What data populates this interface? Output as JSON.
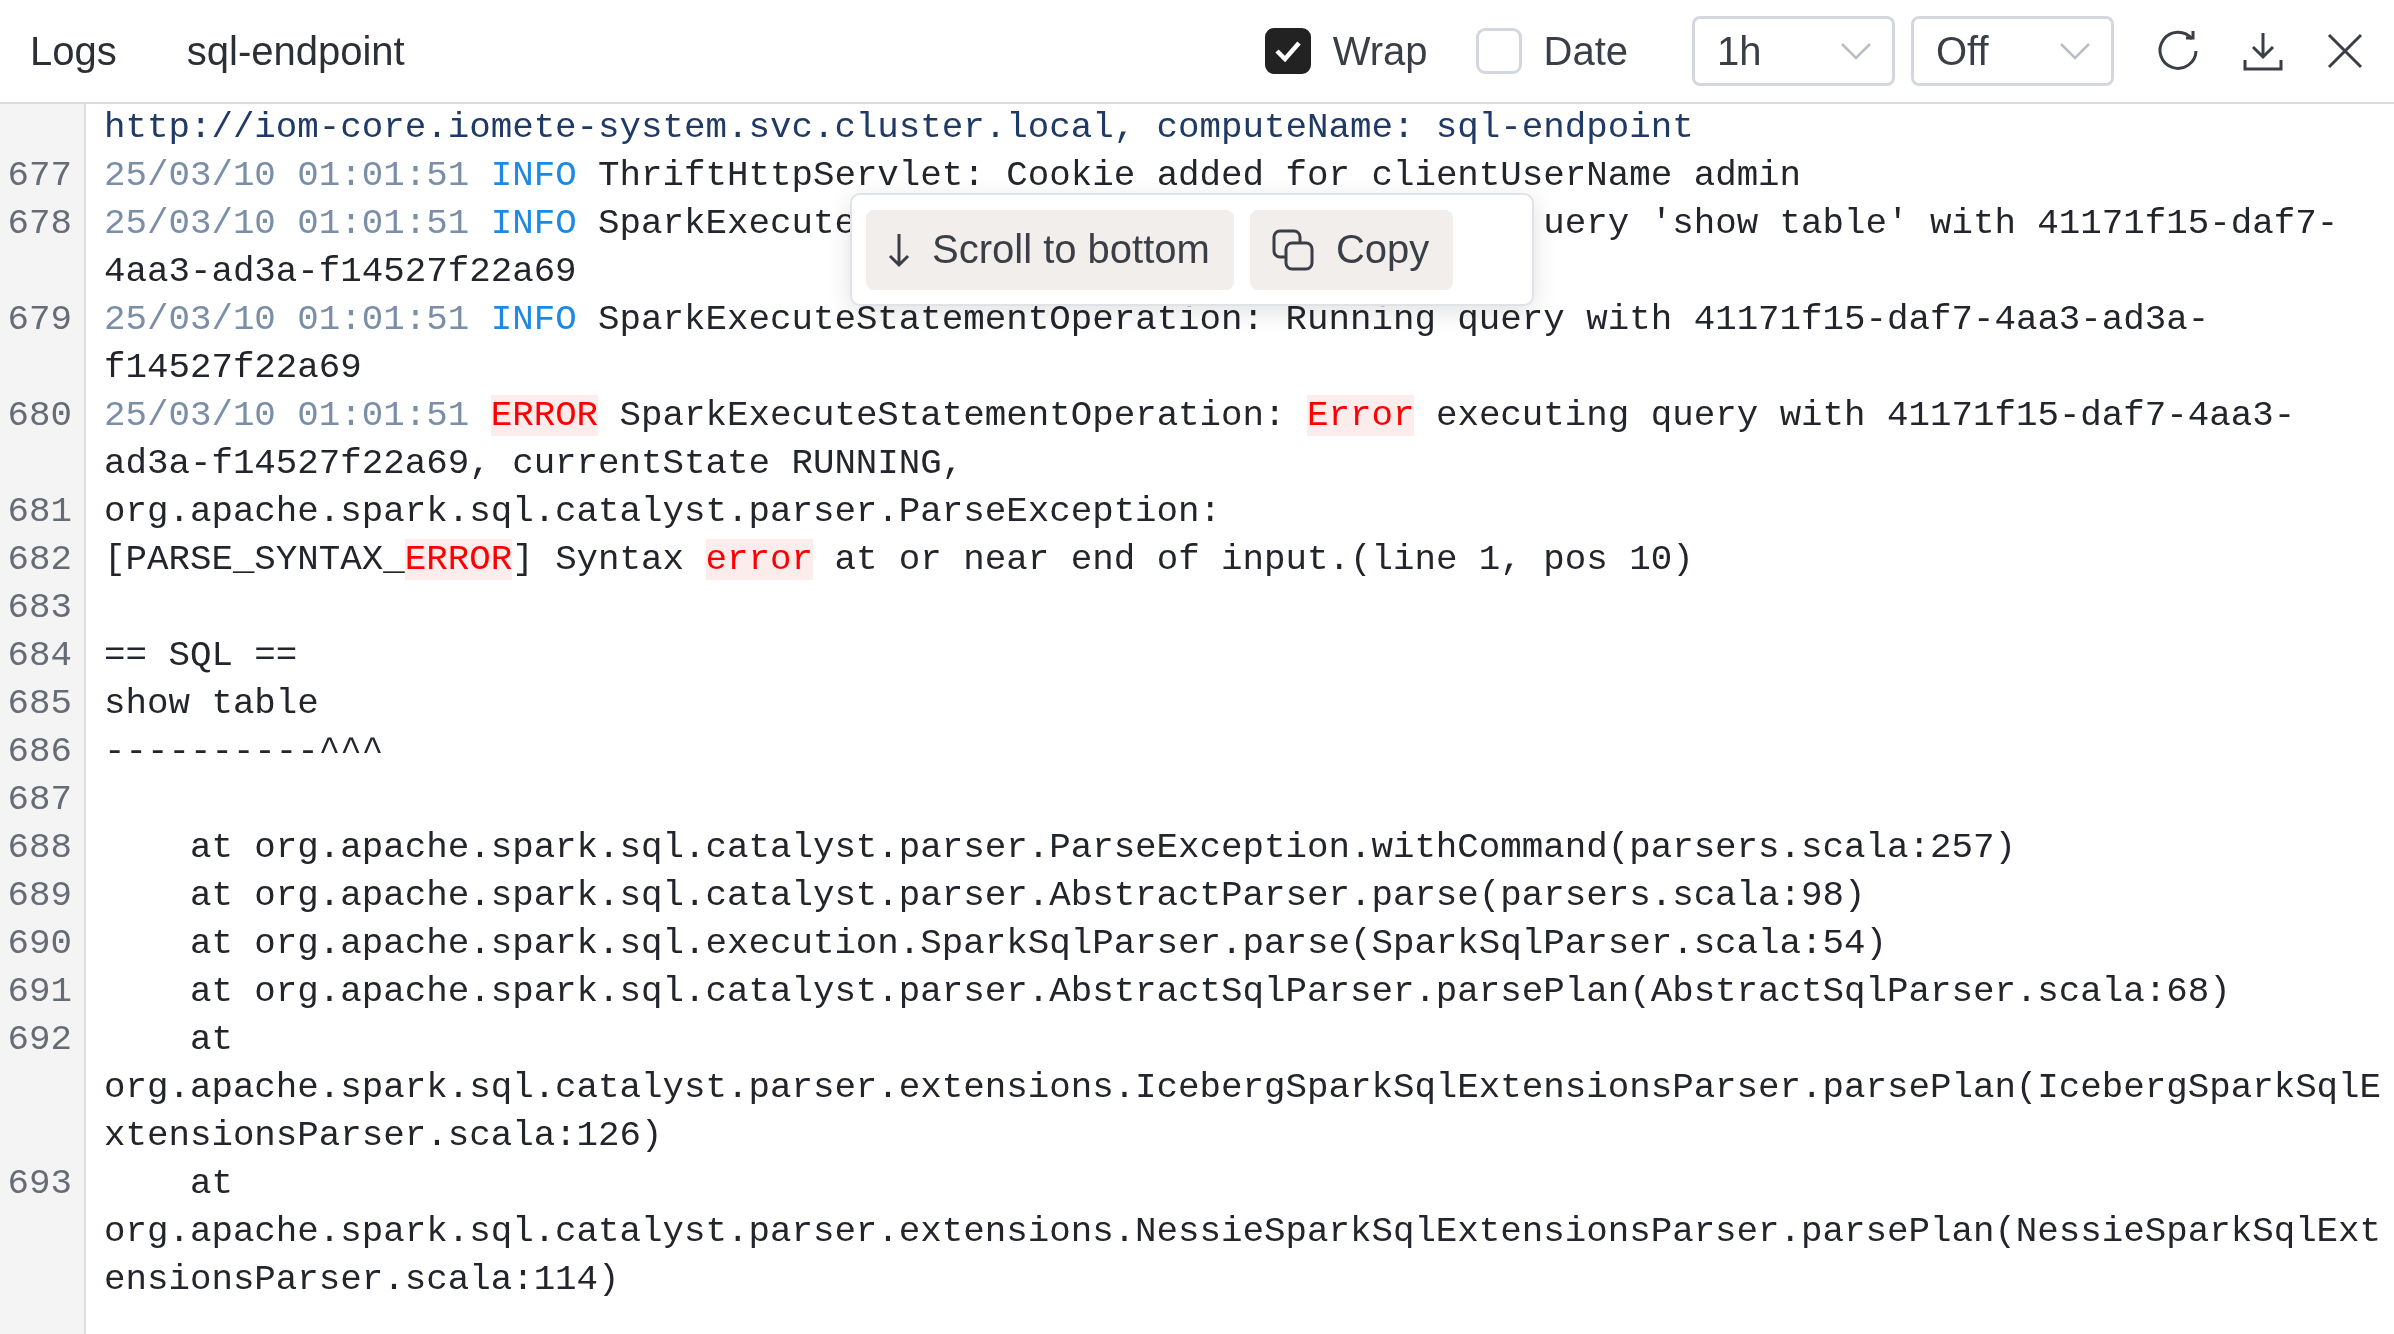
{
  "header": {
    "title": "Logs",
    "source": "sql-endpoint",
    "toggles": [
      {
        "label": "Wrap",
        "checked": true
      },
      {
        "label": "Date",
        "checked": false
      }
    ],
    "selects": [
      {
        "value": "1h"
      },
      {
        "value": "Off"
      }
    ]
  },
  "log": [
    {
      "rows": [
        [
          {
            "kind": "url",
            "text": "http://iom-core.iomete-system.svc.cluster.local, computeName: sql-endpoint"
          }
        ]
      ]
    },
    {
      "number": "677",
      "rows": [
        [
          {
            "kind": "time",
            "text": "25/03/10 01:01:51"
          },
          {
            "kind": "text",
            "text": " "
          },
          {
            "kind": "info",
            "text": "INFO"
          },
          {
            "kind": "text",
            "text": " ThriftHttpServlet: Cookie added for clientUserName admin"
          }
        ]
      ]
    },
    {
      "number": "678",
      "rows": [
        [
          {
            "kind": "time",
            "text": "25/03/10 01:01:51"
          },
          {
            "kind": "text",
            "text": " "
          },
          {
            "kind": "info",
            "text": "INFO"
          },
          {
            "kind": "text",
            "text": " SparkExecute"
          },
          {
            "kind": "covered"
          },
          {
            "kind": "text",
            "text": "uery 'show table' with 41171f15-daf7-"
          }
        ],
        [
          {
            "kind": "text",
            "text": "4aa3-ad3a-f14527f22a69"
          }
        ]
      ]
    },
    {
      "number": "679",
      "rows": [
        [
          {
            "kind": "time",
            "text": "25/03/10 01:01:51"
          },
          {
            "kind": "text",
            "text": " "
          },
          {
            "kind": "info",
            "text": "INFO"
          },
          {
            "kind": "text",
            "text": " SparkExecuteStatementOperation: Running query with 41171f15-daf7-4aa3-ad3a-"
          }
        ],
        [
          {
            "kind": "text",
            "text": "f14527f22a69"
          }
        ]
      ]
    },
    {
      "number": "680",
      "rows": [
        [
          {
            "kind": "time",
            "text": "25/03/10 01:01:51"
          },
          {
            "kind": "text",
            "text": " "
          },
          {
            "kind": "error",
            "text": "ERROR"
          },
          {
            "kind": "text",
            "text": " SparkExecuteStatementOperation: "
          },
          {
            "kind": "error",
            "text": "Error"
          },
          {
            "kind": "text",
            "text": " executing query with 41171f15-daf7-4aa3-"
          }
        ],
        [
          {
            "kind": "text",
            "text": "ad3a-f14527f22a69, currentState RUNNING,"
          }
        ]
      ]
    },
    {
      "number": "681",
      "rows": [
        [
          {
            "kind": "text",
            "text": "org.apache.spark.sql.catalyst.parser.ParseException:"
          }
        ]
      ]
    },
    {
      "number": "682",
      "rows": [
        [
          {
            "kind": "text",
            "text": "[PARSE_SYNTAX_"
          },
          {
            "kind": "error",
            "text": "ERROR"
          },
          {
            "kind": "text",
            "text": "] Syntax "
          },
          {
            "kind": "error",
            "text": "error"
          },
          {
            "kind": "text",
            "text": " at or near end of input.(line 1, pos 10)"
          }
        ]
      ]
    },
    {
      "number": "683",
      "rows": [
        []
      ]
    },
    {
      "number": "684",
      "rows": [
        [
          {
            "kind": "text",
            "text": "== SQL =="
          }
        ]
      ]
    },
    {
      "number": "685",
      "rows": [
        [
          {
            "kind": "text",
            "text": "show table"
          }
        ]
      ]
    },
    {
      "number": "686",
      "rows": [
        [
          {
            "kind": "text",
            "text": "----------^^^"
          }
        ]
      ]
    },
    {
      "number": "687",
      "rows": [
        []
      ]
    },
    {
      "number": "688",
      "rows": [
        [
          {
            "kind": "text",
            "text": "    at org.apache.spark.sql.catalyst.parser.ParseException.withCommand(parsers.scala:257)"
          }
        ]
      ]
    },
    {
      "number": "689",
      "rows": [
        [
          {
            "kind": "text",
            "text": "    at org.apache.spark.sql.catalyst.parser.AbstractParser.parse(parsers.scala:98)"
          }
        ]
      ]
    },
    {
      "number": "690",
      "rows": [
        [
          {
            "kind": "text",
            "text": "    at org.apache.spark.sql.execution.SparkSqlParser.parse(SparkSqlParser.scala:54)"
          }
        ]
      ]
    },
    {
      "number": "691",
      "rows": [
        [
          {
            "kind": "text",
            "text": "    at org.apache.spark.sql.catalyst.parser.AbstractSqlParser.parsePlan(AbstractSqlParser.scala:68)"
          }
        ]
      ]
    },
    {
      "number": "692",
      "rows": [
        [
          {
            "kind": "text",
            "text": "    at"
          }
        ],
        [
          {
            "kind": "text",
            "text": "org.apache.spark.sql.catalyst.parser.extensions.IcebergSparkSqlExtensionsParser.parsePlan(IcebergSparkSqlE"
          }
        ],
        [
          {
            "kind": "text",
            "text": "xtensionsParser.scala:126)"
          }
        ]
      ]
    },
    {
      "number": "693",
      "rows": [
        [
          {
            "kind": "text",
            "text": "    at"
          }
        ],
        [
          {
            "kind": "text",
            "text": "org.apache.spark.sql.catalyst.parser.extensions.NessieSparkSqlExtensionsParser.parsePlan(NessieSparkSqlExt"
          }
        ],
        [
          {
            "kind": "text",
            "text": "ensionsParser.scala:114)"
          }
        ]
      ]
    }
  ],
  "popup": {
    "buttons": [
      {
        "kind": "scroll",
        "label": "Scroll to bottom"
      },
      {
        "kind": "copy",
        "label": "Copy"
      }
    ]
  }
}
